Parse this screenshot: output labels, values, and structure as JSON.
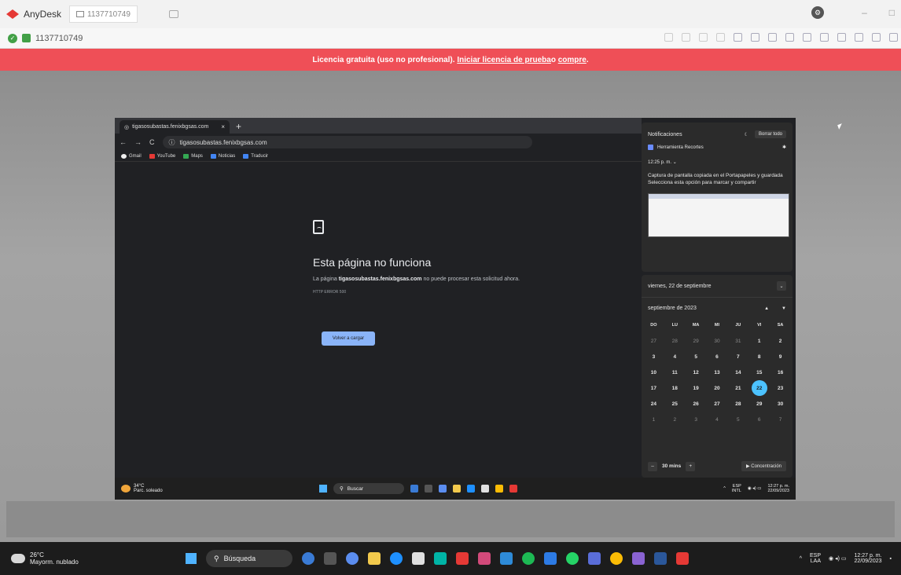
{
  "anydesk": {
    "app_title": "AnyDesk",
    "tab_id": "1137710749",
    "address_id": "1137710749",
    "banner": {
      "prefix": "Licencia gratuita (uso no profesional). ",
      "link1": "Iniciar licencia de prueba",
      "middle": " o ",
      "link2": "compre",
      "suffix": "."
    },
    "window_controls": {
      "minimize": "–",
      "maximize": "□",
      "close": "✕"
    }
  },
  "browser": {
    "tab_title": "tigasosubastas.fenixbgsas.com",
    "tab_close": "×",
    "new_tab": "+",
    "url": "tigasosubastas.fenixbgsas.com",
    "nav": {
      "back": "←",
      "forward": "→",
      "reload": "C"
    },
    "bookmarks": [
      "Gmail",
      "YouTube",
      "Maps",
      "Noticias",
      "Traducir"
    ]
  },
  "error_page": {
    "title": "Esta página no funciona",
    "message_prefix": "La página ",
    "message_host": "tigasosubastas.fenixbgsas.com",
    "message_suffix": " no puede procesar esta solicitud ahora.",
    "code": "HTTP ERROR 500",
    "button": "Volver a cargar"
  },
  "notifications": {
    "title": "Notificaciones",
    "clear_all": "Borrar todo",
    "app_name": "Herramienta Recortes",
    "time": "12:25 p. m.",
    "body_title": "Captura de pantalla copiada en el Portapapeles y guardada",
    "body_text": "Selecciona esta opción para marcar y compartir"
  },
  "calendar": {
    "date_header": "viernes, 22 de septiembre",
    "month": "septiembre de 2023",
    "weekdays": [
      "DO",
      "LU",
      "MA",
      "MI",
      "JU",
      "VI",
      "SA"
    ],
    "days": [
      {
        "d": "27",
        "dim": true
      },
      {
        "d": "28",
        "dim": true
      },
      {
        "d": "29",
        "dim": true
      },
      {
        "d": "30",
        "dim": true
      },
      {
        "d": "31",
        "dim": true
      },
      {
        "d": "1"
      },
      {
        "d": "2"
      },
      {
        "d": "3"
      },
      {
        "d": "4"
      },
      {
        "d": "5"
      },
      {
        "d": "6"
      },
      {
        "d": "7"
      },
      {
        "d": "8"
      },
      {
        "d": "9"
      },
      {
        "d": "10"
      },
      {
        "d": "11"
      },
      {
        "d": "12"
      },
      {
        "d": "13"
      },
      {
        "d": "14"
      },
      {
        "d": "15"
      },
      {
        "d": "16"
      },
      {
        "d": "17"
      },
      {
        "d": "18"
      },
      {
        "d": "19"
      },
      {
        "d": "20"
      },
      {
        "d": "21"
      },
      {
        "d": "22",
        "today": true
      },
      {
        "d": "23"
      },
      {
        "d": "24"
      },
      {
        "d": "25"
      },
      {
        "d": "26"
      },
      {
        "d": "27"
      },
      {
        "d": "28"
      },
      {
        "d": "29"
      },
      {
        "d": "30"
      },
      {
        "d": "1",
        "dim": true
      },
      {
        "d": "2",
        "dim": true
      },
      {
        "d": "3",
        "dim": true
      },
      {
        "d": "4",
        "dim": true
      },
      {
        "d": "5",
        "dim": true
      },
      {
        "d": "6",
        "dim": true
      },
      {
        "d": "7",
        "dim": true
      }
    ],
    "focus_minutes": "30 mins",
    "focus_button": "Concentración",
    "minus": "–",
    "plus": "+"
  },
  "remote_taskbar": {
    "temp": "34°C",
    "weather": "Parc. soleado",
    "search": "Buscar",
    "lang": "ESP",
    "layout": "INTL",
    "time": "12:27 p. m.",
    "date": "22/09/2023"
  },
  "local_taskbar": {
    "temp": "26°C",
    "weather": "Mayorm. nublado",
    "search": "Búsqueda",
    "lang": "ESP",
    "layout": "LAA",
    "time": "12:27 p. m.",
    "date": "22/09/2023"
  },
  "colors": {
    "banner": "#ef4f57",
    "accent": "#4cc2ff",
    "reload_button": "#8ab4f8",
    "remote_bg": "#202124"
  }
}
